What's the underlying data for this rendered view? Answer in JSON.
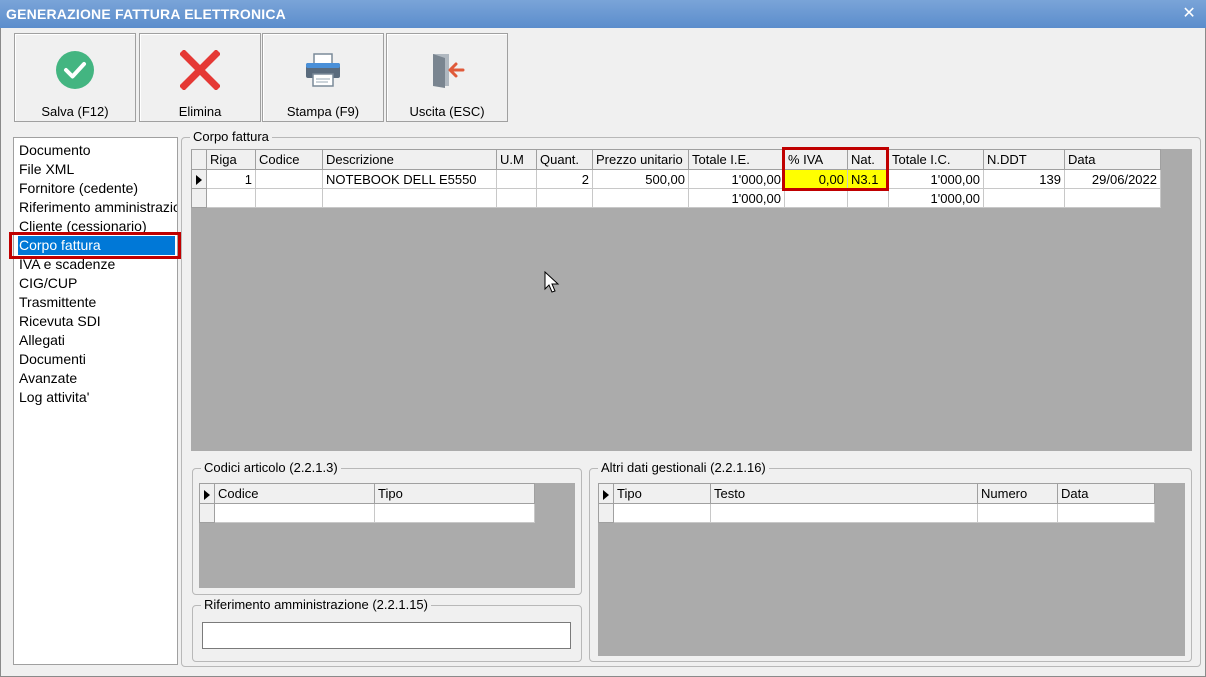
{
  "window": {
    "title": "GENERAZIONE FATTURA ELETTRONICA",
    "close_glyph": "✕"
  },
  "toolbar": {
    "save_label": "Salva (F12)",
    "delete_label": "Elimina",
    "print_label": "Stampa (F9)",
    "exit_label": "Uscita (ESC)",
    "icons": {
      "save": "check-circle-icon",
      "delete": "red-x-icon",
      "print": "printer-icon",
      "exit": "exit-door-icon"
    },
    "colors": {
      "save": "#43b581",
      "delete": "#e53935",
      "exit_arrow": "#e05a3a"
    }
  },
  "nav": {
    "items": [
      "Documento",
      "File XML",
      "Fornitore (cedente)",
      "Riferimento amministrazione",
      "Cliente (cessionario)",
      "Corpo fattura",
      "IVA e scadenze",
      "CIG/CUP",
      "Trasmittente",
      "Ricevuta SDI",
      "Allegati",
      "Documenti",
      "Avanzate",
      "Log attivita'"
    ],
    "selected": "Corpo fattura"
  },
  "corpo": {
    "legend": "Corpo fattura",
    "columns": [
      "Riga",
      "Codice",
      "Descrizione",
      "U.M",
      "Quant.",
      "Prezzo unitario",
      "Totale I.E.",
      "% IVA",
      "Nat.",
      "Totale I.C.",
      "N.DDT",
      "Data"
    ],
    "rows": [
      {
        "riga": "1",
        "codice": "",
        "descrizione": "NOTEBOOK DELL E5550",
        "um": "",
        "quant": "2",
        "prezzo": "500,00",
        "totale_ie": "1'000,00",
        "iva": "0,00",
        "nat": "N3.1",
        "totale_ic": "1'000,00",
        "nddt": "139",
        "data": "29/06/2022"
      }
    ],
    "totals": {
      "totale_ie": "1'000,00",
      "totale_ic": "1'000,00"
    }
  },
  "codici": {
    "legend": "Codici articolo (2.2.1.3)",
    "columns": [
      "Codice",
      "Tipo"
    ]
  },
  "altri": {
    "legend": "Altri dati gestionali (2.2.1.16)",
    "columns": [
      "Tipo",
      "Testo",
      "Numero",
      "Data"
    ]
  },
  "riferimento": {
    "legend": "Riferimento amministrazione (2.2.1.15)",
    "value": ""
  },
  "colors": {
    "highlight": "#c00000",
    "selection": "#0078d7",
    "yellow": "#ffff00",
    "grid_bg": "#ababab"
  }
}
